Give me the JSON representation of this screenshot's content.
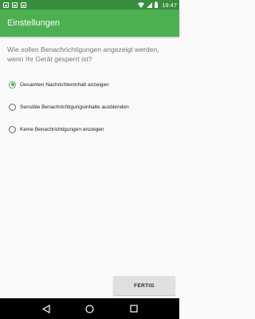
{
  "status_bar": {
    "time": "19:47",
    "left_icons": [
      "image-notification-icon",
      "image-notification-icon",
      "image-notification-icon"
    ],
    "right_icons": [
      "wifi-icon",
      "signal-icon",
      "battery-icon"
    ],
    "color": "#388e3c"
  },
  "app_bar": {
    "title": "Einstellungen",
    "color": "#4caf50"
  },
  "question": "Wie sollen Benachrichtigungen angezeigt werden, wenn Ihr Gerät gesperrt ist?",
  "options": [
    {
      "label": "Gesamten Nachrichteninhalt anzeigen",
      "checked": true
    },
    {
      "label": "Sensible Benachrichtigungsinhalte ausblenden",
      "checked": false
    },
    {
      "label": "Keine Benachrichtigungen anzeigen",
      "checked": false
    }
  ],
  "done_button": {
    "label": "FERTIG"
  },
  "nav_bar": {
    "icons": [
      "back-icon",
      "home-icon",
      "recents-icon"
    ]
  }
}
